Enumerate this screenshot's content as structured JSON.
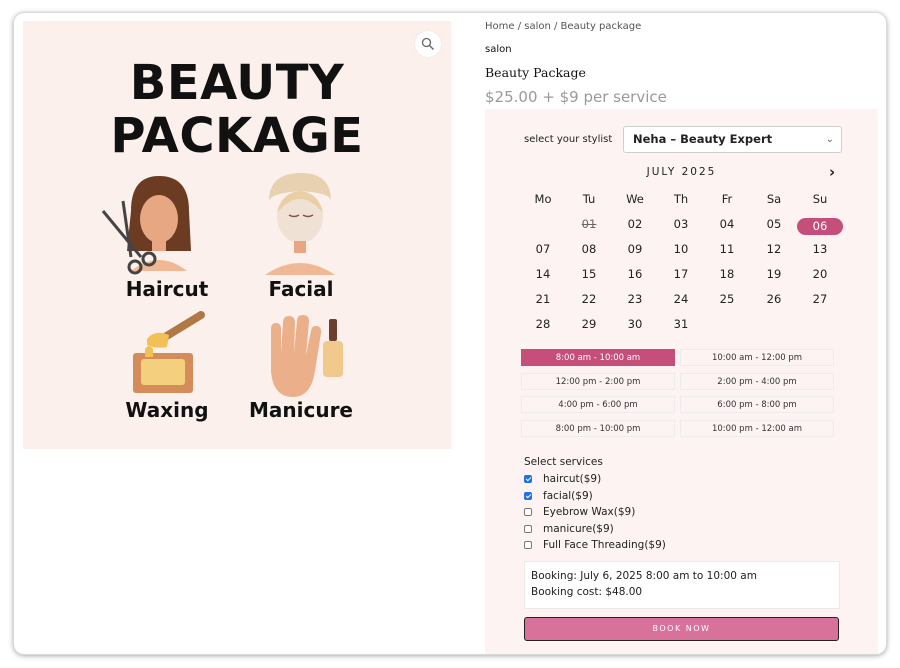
{
  "image": {
    "title_line1": "BEAUTY",
    "title_line2": "PACKAGE",
    "captions": [
      "Haircut",
      "Facial",
      "Waxing",
      "Manicure"
    ],
    "zoom_icon": "magnifier-icon"
  },
  "breadcrumb": "Home / salon / Beauty package",
  "category": "salon",
  "product_title": "Beauty Package",
  "price": "$25.00 + $9 per service",
  "booking": {
    "stylist_label": "select your stylist",
    "stylist_value": "Neha – Beauty Expert",
    "month": "JULY 2025",
    "next_icon": "chevron-right-icon",
    "weekdays": [
      "Mo",
      "Tu",
      "We",
      "Th",
      "Fr",
      "Sa",
      "Su"
    ],
    "days": [
      "01",
      "02",
      "03",
      "04",
      "05",
      "06",
      "07",
      "08",
      "09",
      "10",
      "11",
      "12",
      "13",
      "14",
      "15",
      "16",
      "17",
      "18",
      "19",
      "20",
      "21",
      "22",
      "23",
      "24",
      "25",
      "26",
      "27",
      "28",
      "29",
      "30",
      "31"
    ],
    "past_day": "01",
    "selected_day": "06",
    "slots": [
      "8:00 am - 10:00 am",
      "10:00 am - 12:00 pm",
      "12:00 pm - 2:00 pm",
      "2:00 pm - 4:00 pm",
      "4:00 pm - 6:00 pm",
      "6:00 pm - 8:00 pm",
      "8:00 pm - 10:00 pm",
      "10:00 pm - 12:00 am"
    ],
    "selected_slot": "8:00 am - 10:00 am",
    "services_heading": "Select services",
    "services": [
      {
        "label": "haircut($9)",
        "checked": true
      },
      {
        "label": "facial($9)",
        "checked": true
      },
      {
        "label": "Eyebrow Wax($9)",
        "checked": false
      },
      {
        "label": "manicure($9)",
        "checked": false
      },
      {
        "label": "Full Face Threading($9)",
        "checked": false
      }
    ],
    "summary_line1": "Booking: July 6, 2025 8:00 am to 10:00 am",
    "summary_line2": "Booking cost: $48.00",
    "book_label": "BOOK NOW"
  },
  "colors": {
    "accent": "#c54e7b",
    "button": "#d9729a",
    "panel": "#fcf3f2",
    "hero_bg": "#fbf0ec"
  }
}
